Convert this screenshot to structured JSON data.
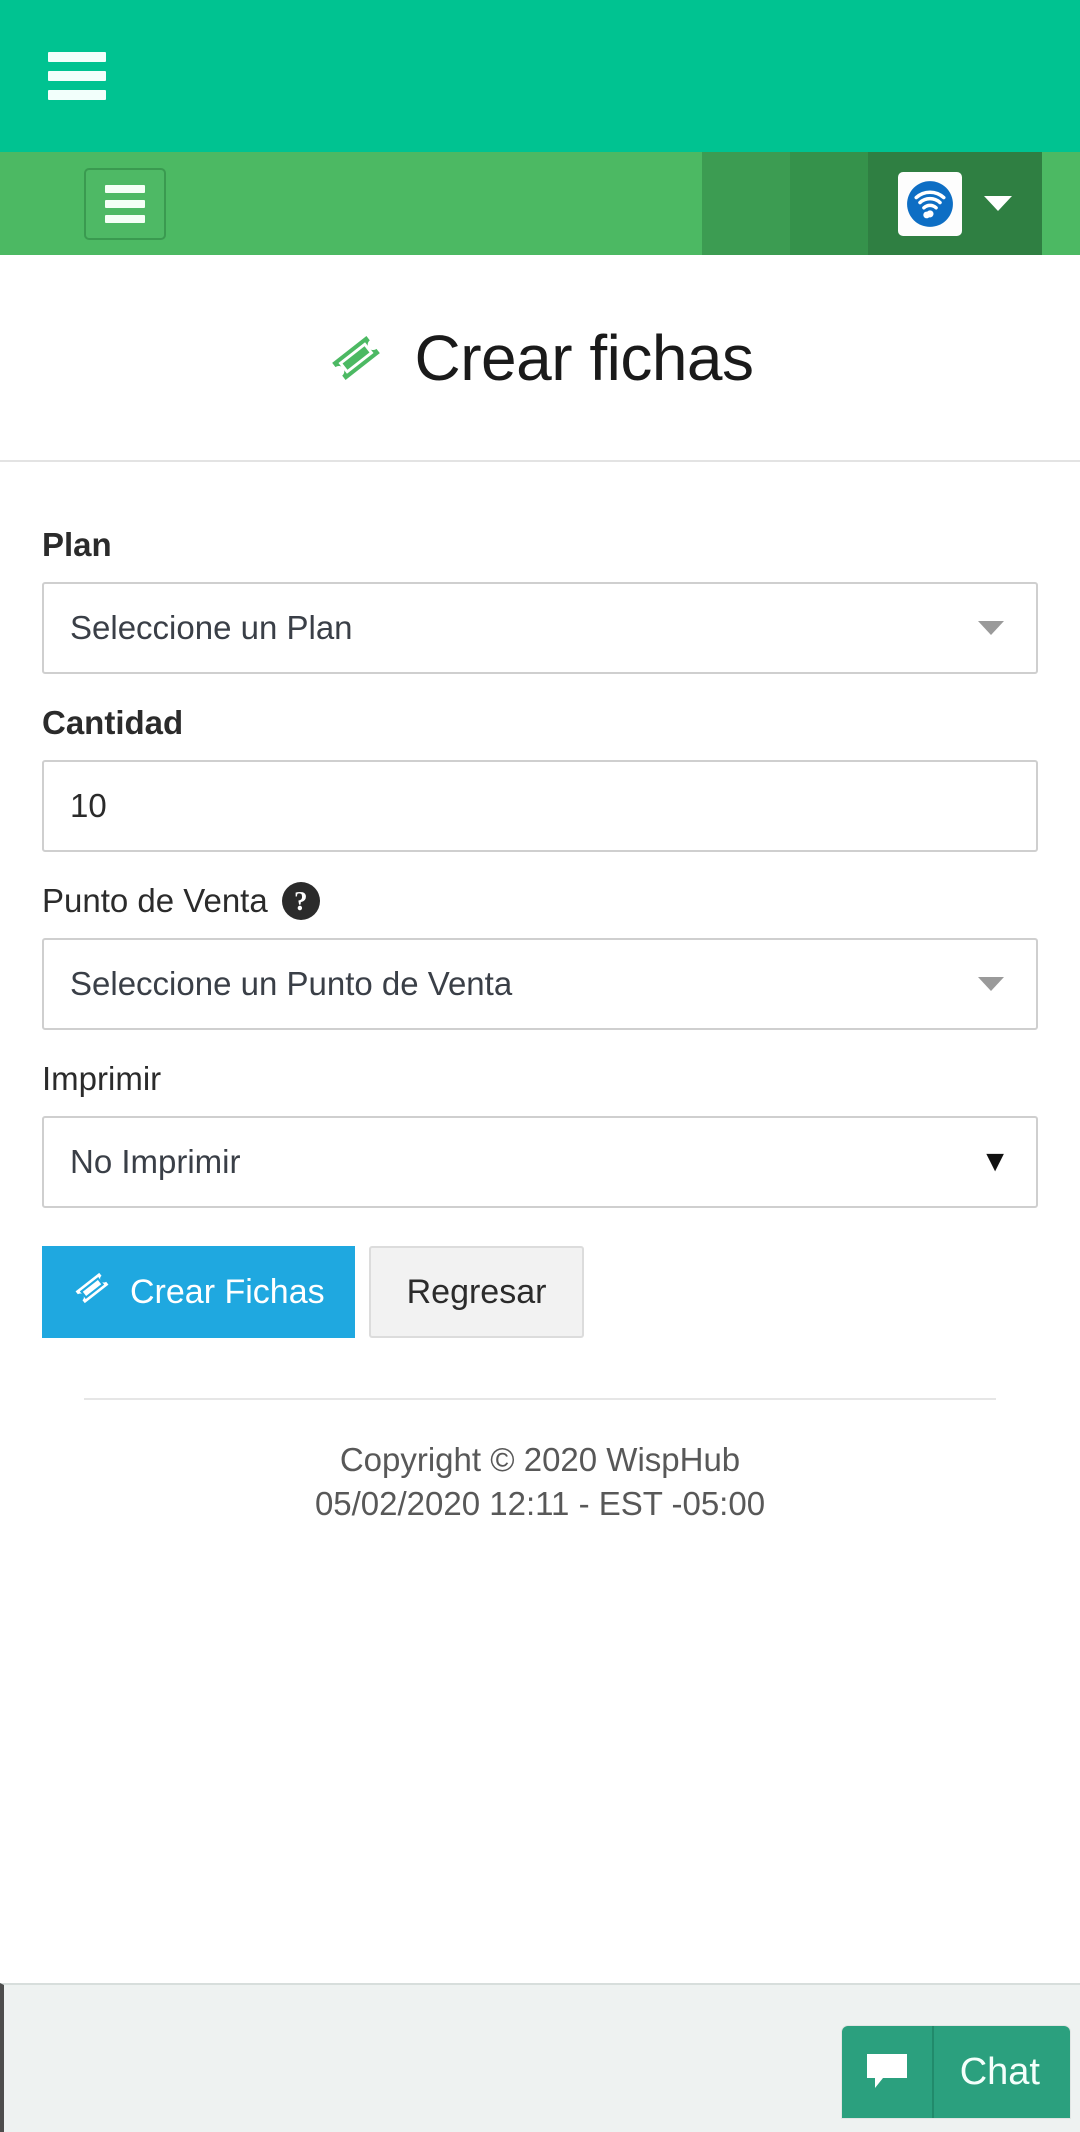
{
  "colors": {
    "appbar_teal": "#00c391",
    "navbar_green": "#4cb963",
    "nav_dark_green": "#2f7f42",
    "title_icon_green": "#4cb963",
    "primary_blue": "#1fa8e0",
    "chat_teal": "#2ba07e"
  },
  "appbar": {
    "menu_icon": "hamburger-menu-icon"
  },
  "navbar": {
    "toggle_icon": "hamburger-menu-icon",
    "brand_icon": "wifi-signal-icon",
    "dropdown_icon": "caret-down-icon"
  },
  "header": {
    "icon": "ticket-icon",
    "title": "Crear fichas"
  },
  "form": {
    "fields": [
      {
        "name": "plan",
        "label": "Plan",
        "bold": true,
        "type": "select",
        "value": "Seleccione un Plan",
        "caret": "caret-down-icon",
        "help": null
      },
      {
        "name": "cantidad",
        "label": "Cantidad",
        "bold": true,
        "type": "number",
        "value": "10",
        "placeholder": "10",
        "caret": null,
        "help": null
      },
      {
        "name": "punto-de-venta",
        "label": "Punto de Venta",
        "bold": false,
        "type": "select",
        "value": "Seleccione un Punto de Venta",
        "caret": "caret-down-icon",
        "help": "?"
      },
      {
        "name": "imprimir",
        "label": "Imprimir",
        "bold": false,
        "type": "select-native",
        "value": "No Imprimir",
        "caret": "▼",
        "help": null
      }
    ],
    "buttons": {
      "submit_icon": "ticket-icon",
      "submit_label": "Crear Fichas",
      "back_label": "Regresar"
    }
  },
  "footer": {
    "copyright": "Copyright © 2020 WispHub",
    "timestamp": "05/02/2020 12:11 - EST -05:00"
  },
  "chat": {
    "icon": "chat-bubble-icon",
    "label": "Chat"
  }
}
